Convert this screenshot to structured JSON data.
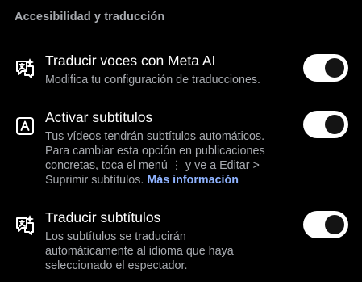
{
  "section": {
    "title": "Accesibilidad y traducción"
  },
  "settings": [
    {
      "icon": "translate-sparkle-icon",
      "title": "Traducir voces con Meta AI",
      "description": "Modifica tu configuración de traducciones.",
      "enabled": true
    },
    {
      "icon": "captions-a-icon",
      "title": "Activar subtítulos",
      "description_lines": [
        "Tus vídeos tendrán subtítulos automáticos.",
        "Para cambiar esta opción en publicaciones",
        "concretas, toca el menú ⋮ y ve a Editar >",
        "Suprimir subtítulos."
      ],
      "link": "Más información",
      "enabled": true
    },
    {
      "icon": "translate-sparkle-icon",
      "title": "Traducir subtítulos",
      "description_lines": [
        "Los subtítulos se traducirán",
        "automáticamente al idioma que haya",
        "seleccionado el espectador."
      ],
      "enabled": true
    }
  ],
  "colors": {
    "background": "#000000",
    "text_primary": "#ffffff",
    "text_secondary": "#a8abb0",
    "link": "#8fb3ff",
    "toggle_track": "#ffffff",
    "toggle_knob": "#141414"
  }
}
